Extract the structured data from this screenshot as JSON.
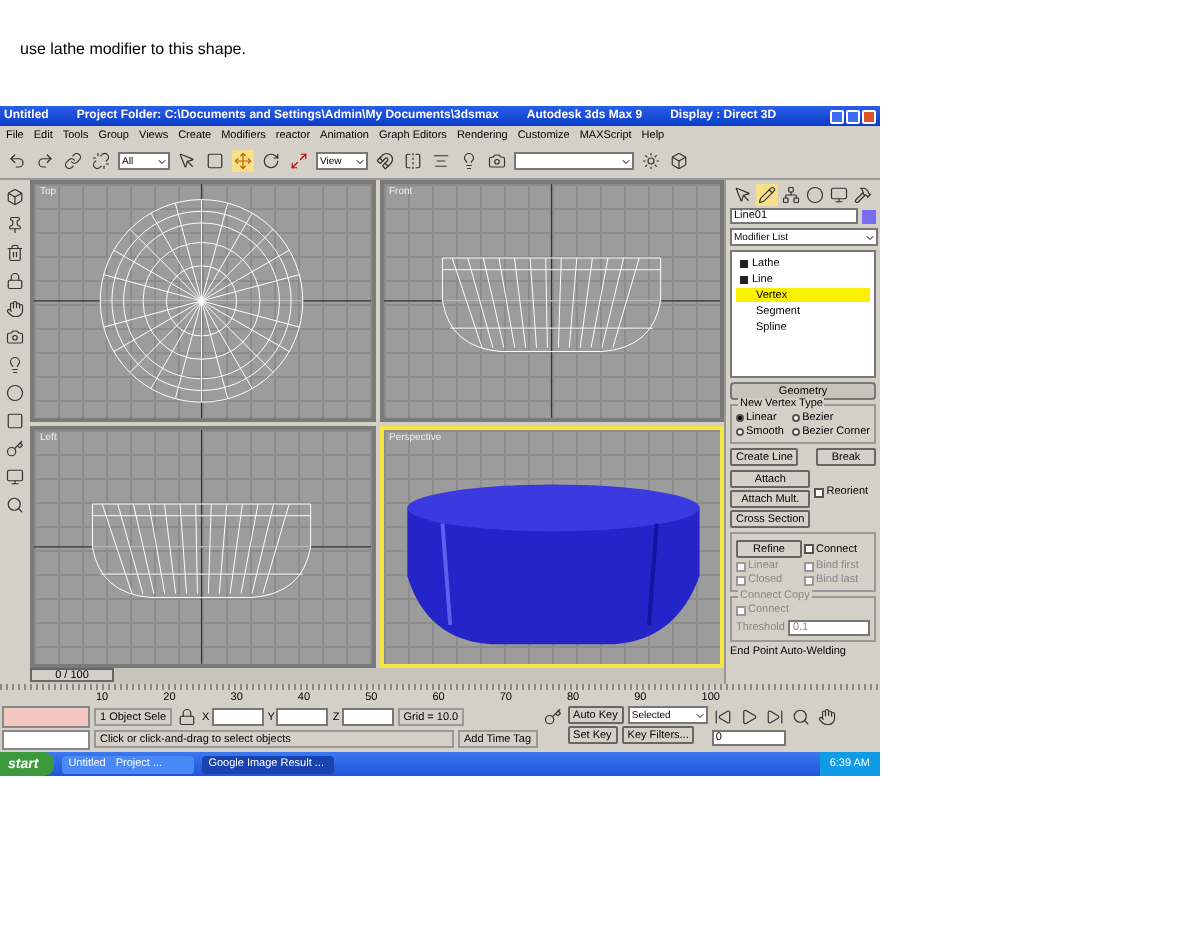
{
  "instruction": "use lathe modifier to this shape.",
  "window": {
    "title": "Untitled",
    "project": "Project Folder: C:\\Documents and Settings\\Admin\\My Documents\\3dsmax",
    "app": "Autodesk 3ds Max 9",
    "display": "Display : Direct 3D"
  },
  "menu": [
    "File",
    "Edit",
    "Tools",
    "Group",
    "Views",
    "Create",
    "Modifiers",
    "reactor",
    "Animation",
    "Graph Editors",
    "Rendering",
    "Customize",
    "MAXScript",
    "Help"
  ],
  "toolbar": {
    "selection_filter": "All",
    "coordinate_system": "View"
  },
  "viewports": [
    {
      "label": "Top",
      "active": false,
      "kind": "top"
    },
    {
      "label": "Front",
      "active": false,
      "kind": "side"
    },
    {
      "label": "Left",
      "active": false,
      "kind": "side"
    },
    {
      "label": "Perspective",
      "active": true,
      "kind": "shaded"
    }
  ],
  "command_panel": {
    "object_name": "Line01",
    "modifier_list": "Modifier List",
    "stack": [
      {
        "label": "Lathe",
        "selected": false
      },
      {
        "label": "Line",
        "selected": false,
        "children": [
          {
            "label": "Vertex",
            "selected": true
          },
          {
            "label": "Segment",
            "selected": false
          },
          {
            "label": "Spline",
            "selected": false
          }
        ]
      }
    ],
    "rollout": "Geometry",
    "vertex_type_group": "New Vertex Type",
    "vertex_types": [
      {
        "label": "Linear",
        "selected": true
      },
      {
        "label": "Bezier",
        "selected": false
      },
      {
        "label": "Smooth",
        "selected": false
      },
      {
        "label": "Bezier Corner",
        "selected": false
      }
    ],
    "buttons": [
      {
        "label": "Create Line"
      },
      {
        "label": "Break"
      },
      {
        "label": "Attach"
      },
      {
        "label": "Attach Mult."
      },
      {
        "label": "Cross Section"
      }
    ],
    "reorient": {
      "label": "Reorient",
      "checked": false
    },
    "refine": "Refine",
    "checks": [
      {
        "label": "Connect",
        "checked": false,
        "disabled": false
      },
      {
        "label": "Linear",
        "checked": false,
        "disabled": true
      },
      {
        "label": "Bind first",
        "checked": false,
        "disabled": true
      },
      {
        "label": "Closed",
        "checked": false,
        "disabled": true
      },
      {
        "label": "Bind last",
        "checked": false,
        "disabled": true
      }
    ],
    "connect_copy": {
      "group": "Connect Copy",
      "label": "Connect",
      "checked": false,
      "disabled": true,
      "threshold_label": "Threshold",
      "threshold": "0.1"
    },
    "auto_weld": "End Point Auto-Welding"
  },
  "time_slider": {
    "label": "0 / 100",
    "level": 0
  },
  "track_ticks": [
    "10",
    "20",
    "30",
    "40",
    "50",
    "60",
    "70",
    "80",
    "90",
    "100"
  ],
  "status": {
    "selection": "1 Object Sele",
    "x_label": "X",
    "y_label": "Y",
    "z_label": "Z",
    "grid": "Grid = 10.0",
    "prompt": "Click or click-and-drag to select objects",
    "time_tag": "Add Time Tag",
    "auto_key": "Auto Key",
    "key_mode": "Selected",
    "set_key": "Set Key",
    "key_filters": "Key Filters...",
    "frame": "0"
  },
  "taskbar": {
    "start": "start",
    "tasks": [
      {
        "label": "Untitled",
        "sub": "Project ...",
        "selected": false
      },
      {
        "label": "Google Image Result ...",
        "selected": true
      }
    ],
    "clock": "6:39 AM"
  }
}
